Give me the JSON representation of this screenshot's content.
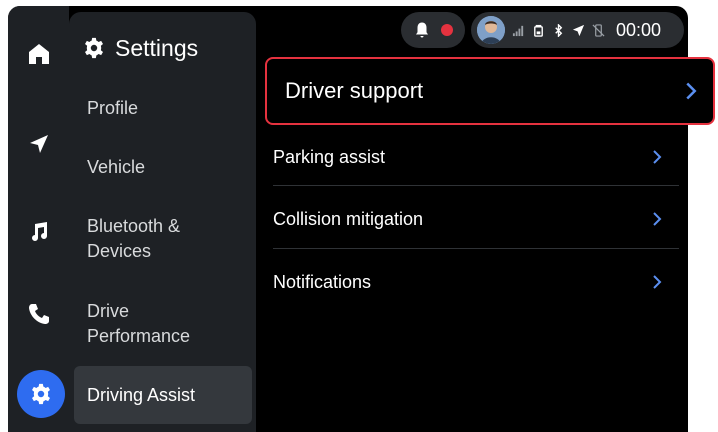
{
  "colors": {
    "accent": "#2e6cf0",
    "highlight_border": "#e5323f",
    "chevron": "#5b8ff0",
    "alert_dot": "#e5323f"
  },
  "rail": {
    "items": [
      {
        "icon": "home-icon"
      },
      {
        "icon": "navigation-icon"
      },
      {
        "icon": "music-icon"
      },
      {
        "icon": "phone-icon"
      },
      {
        "icon": "gear-icon",
        "active": true
      }
    ]
  },
  "settings": {
    "title": "Settings",
    "items": [
      {
        "label": "Profile"
      },
      {
        "label": "Vehicle"
      },
      {
        "label": "Bluetooth &\nDevices"
      },
      {
        "label": "Drive\nPerformance"
      },
      {
        "label": "Driving Assist",
        "active": true
      }
    ]
  },
  "status": {
    "time": "00:00",
    "icons": [
      "bell-icon",
      "record-dot-icon",
      "avatar",
      "signal-icon",
      "battery-icon",
      "bluetooth-icon",
      "location-icon",
      "no-phone-icon"
    ]
  },
  "content": {
    "items": [
      {
        "label": "Driver support",
        "highlighted": true
      },
      {
        "label": "Parking assist"
      },
      {
        "label": "Collision mitigation"
      },
      {
        "label": "Notifications"
      }
    ]
  }
}
